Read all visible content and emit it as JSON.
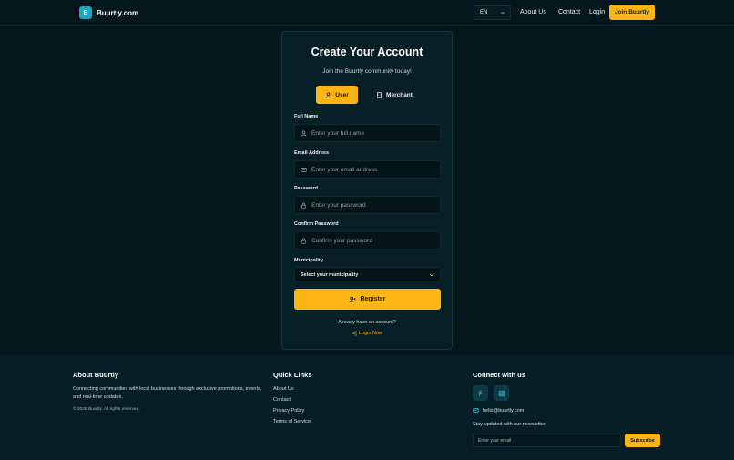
{
  "nav": {
    "logo_mark": "B",
    "brand": "Buurtly.com",
    "language": "EN",
    "about": "About Us",
    "contact": "Contact",
    "login": "Login",
    "join": "Join Buurtly"
  },
  "form": {
    "title": "Create Your Account",
    "subtitle": "Join the Buurtly community today!",
    "role_user": "User",
    "role_merchant": "Merchant",
    "full_name_label": "Full Name",
    "full_name_placeholder": "Enter your full name",
    "email_label": "Email Address",
    "email_placeholder": "Enter your email address",
    "password_label": "Password",
    "password_placeholder": "Enter your password",
    "confirm_label": "Confirm Password",
    "confirm_placeholder": "Confirm your password",
    "municipality_label": "Municipality",
    "municipality_value": "Select your municipality",
    "register": "Register",
    "already": "Already have an account?",
    "login_now": "Login Now"
  },
  "footer": {
    "about_title": "About Buurtly",
    "about_text": "Connecting communities with local businesses through exclusive promotions, events, and real-time updates.",
    "copyright": "© 2025 Buurtly. All rights reserved.",
    "quick_title": "Quick Links",
    "links": [
      "About Us",
      "Contact",
      "Privacy Policy",
      "Terms of Service"
    ],
    "connect_title": "Connect with us",
    "email": "hello@buurtly.com",
    "newsletter_label": "Stay updated with our newsletter",
    "newsletter_placeholder": "Enter your email",
    "subscribe": "Subscribe"
  },
  "colors": {
    "background": "#03171d",
    "accent": "#fdb515",
    "card": "#071f26",
    "footer": "#061e25"
  }
}
